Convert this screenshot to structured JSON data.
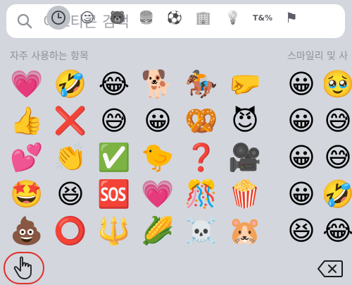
{
  "search": {
    "placeholder": "이모티콘 검색"
  },
  "sections": {
    "frequently_used": "자주 사용하는 항목",
    "smileys": "스마일리 및 사"
  },
  "frequent_emojis": [
    [
      "💗",
      "🤣",
      "😂",
      "🐕",
      "🏇",
      "🤛"
    ],
    [
      "👍",
      "❌",
      "😅",
      "😀",
      "🥨",
      "😈"
    ],
    [
      "💕",
      "👏",
      "✅",
      "🐤",
      "❓",
      "🎥"
    ],
    [
      "🤩",
      "😆",
      "🆘",
      "💗",
      "🎊",
      "🍿"
    ],
    [
      "💩",
      "⭕",
      "🔱",
      "🌽",
      "☠️",
      "🐹"
    ]
  ],
  "smiley_emojis": [
    [
      "😀",
      "🥹"
    ],
    [
      "😀",
      "😅"
    ],
    [
      "😀",
      "😅"
    ],
    [
      "😀",
      "🤣"
    ],
    [
      "😆",
      "😂"
    ]
  ],
  "categories": [
    "frequent",
    "smileys",
    "animals",
    "food",
    "activity",
    "travel",
    "objects",
    "symbols",
    "flags"
  ],
  "category_glyphs": {
    "smileys": "☺",
    "animals": "🐻",
    "food": "🍔",
    "activity": "⚽",
    "travel": "🏢",
    "objects": "💡",
    "symbols": "T&%",
    "flags": "⚑"
  },
  "highlight_color": "#e0312b"
}
